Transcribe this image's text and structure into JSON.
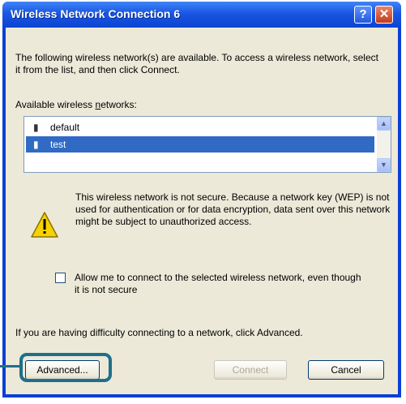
{
  "window": {
    "title": "Wireless Network Connection 6",
    "help_label": "?",
    "close_label": "✕"
  },
  "intro_text": "The following wireless network(s) are available. To access a wireless network, select it from the list, and then click Connect.",
  "networks_label": "Available wireless networks:",
  "networks": [
    {
      "name": "default",
      "selected": false
    },
    {
      "name": "test",
      "selected": true
    }
  ],
  "warning_text": "This wireless network is not secure. Because a network key (WEP) is not used for authentication or for data encryption, data sent over this network might be subject to unauthorized access.",
  "allow_checkbox": {
    "checked": false,
    "label": "Allow me to connect to the selected wireless network, even though it is not secure"
  },
  "trouble_text": "If you are having difficulty connecting to a network, click Advanced.",
  "buttons": {
    "advanced": "Advanced...",
    "connect": "Connect",
    "cancel": "Cancel"
  },
  "icons": {
    "signal": "signal-icon",
    "warning": "warning-icon",
    "scroll_up": "▲",
    "scroll_down": "▼"
  }
}
